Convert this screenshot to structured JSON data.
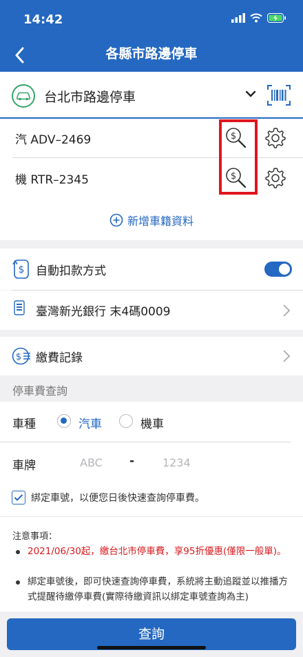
{
  "status_bar": {
    "time": "14:42"
  },
  "nav": {
    "title": "各縣市路邊停車"
  },
  "city": {
    "name": "台北市路邊停車"
  },
  "vehicles": [
    {
      "plate": "汽 ADV–2469"
    },
    {
      "plate": "機 RTR–2345"
    }
  ],
  "add_vehicle": {
    "label": "新增車籍資料"
  },
  "auto_pay": {
    "label": "自動扣款方式",
    "enabled": true
  },
  "bank": {
    "label": "臺灣新光銀行 末4碼0009"
  },
  "payment_history": {
    "label": "繳費記錄"
  },
  "query_section": {
    "title": "停車費查詢",
    "vehicle_type_label": "車種",
    "options": [
      "汽車",
      "機車"
    ],
    "selected": "汽車",
    "plate_label": "車牌",
    "plate_prefix_placeholder": "ABC",
    "plate_dash": "-",
    "plate_suffix_placeholder": "1234",
    "bind_label": "綁定車號，以便您日後快速查詢停車費。"
  },
  "notes": {
    "title": "注意事項：",
    "items": [
      "2021/06/30起，繳台北市停車費，享95折優惠(僅限一般單)。",
      "綁定車號後，即可快速查詢停車費，系統將主動追蹤並以推播方式提醒待繳停車費(實際待繳資訊以綁定車號查詢為主)"
    ]
  },
  "query_button": {
    "label": "查詢"
  },
  "colors": {
    "brand": "#2468c1",
    "highlight": "#e0151d",
    "green": "#35a56a",
    "warning_text": "#d9191c"
  }
}
